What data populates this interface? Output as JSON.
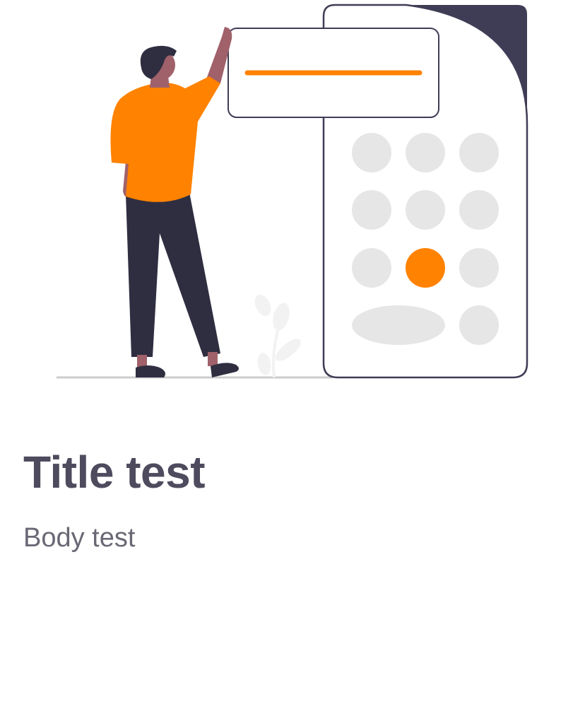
{
  "screen": {
    "title": "Title test",
    "body": "Body test"
  },
  "illustration": {
    "subject": "person-operating-calculator",
    "colors": {
      "accent": "#ff8200",
      "dark": "#3f3d56",
      "pants": "#2f2e41",
      "skin": "#a0616a",
      "key": "#e6e6e6",
      "plant": "#f2f2f2",
      "ground": "#cccccc"
    },
    "keypad": {
      "rows": 4,
      "highlighted_key": "row-3-col-2"
    }
  }
}
